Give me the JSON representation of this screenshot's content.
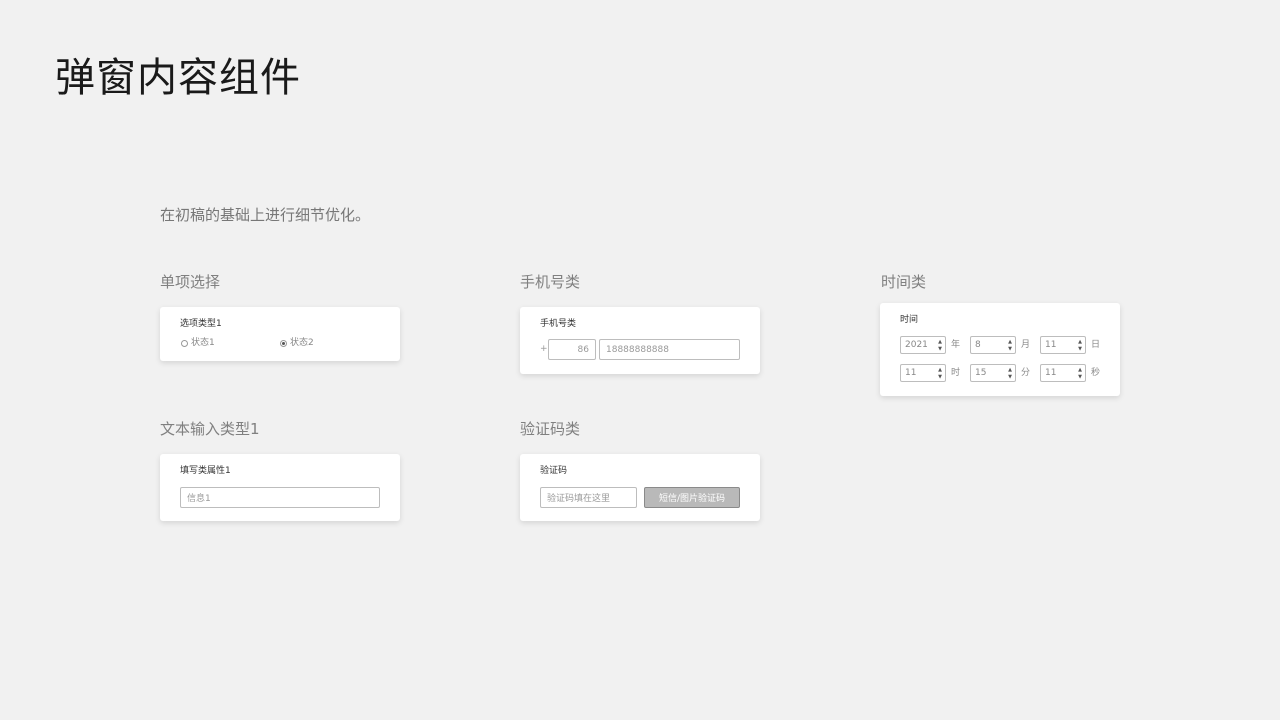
{
  "title": "弹窗内容组件",
  "subtitle": "在初稿的基础上进行细节优化。",
  "radio_section": {
    "heading": "单项选择",
    "label": "选项类型1",
    "options": [
      {
        "label": "状态1",
        "checked": false
      },
      {
        "label": "状态2",
        "checked": true
      }
    ]
  },
  "phone_section": {
    "heading": "手机号类",
    "label": "手机号类",
    "prefix": "+",
    "country_code": "86",
    "number_placeholder": "18888888888"
  },
  "time_section": {
    "heading": "时间类",
    "label": "时间",
    "date": [
      {
        "value": "2021",
        "unit": "年"
      },
      {
        "value": "8",
        "unit": "月"
      },
      {
        "value": "11",
        "unit": "日"
      }
    ],
    "time": [
      {
        "value": "11",
        "unit": "时"
      },
      {
        "value": "15",
        "unit": "分"
      },
      {
        "value": "11",
        "unit": "秒"
      }
    ],
    "up_arrow": "▲",
    "down_arrow": "▼"
  },
  "text_section": {
    "heading": "文本输入类型1",
    "label": "填写类属性1",
    "placeholder": "信息1"
  },
  "captcha_section": {
    "heading": "验证码类",
    "label": "验证码",
    "placeholder": "验证码填在这里",
    "button_label": "短信/图片验证码"
  }
}
